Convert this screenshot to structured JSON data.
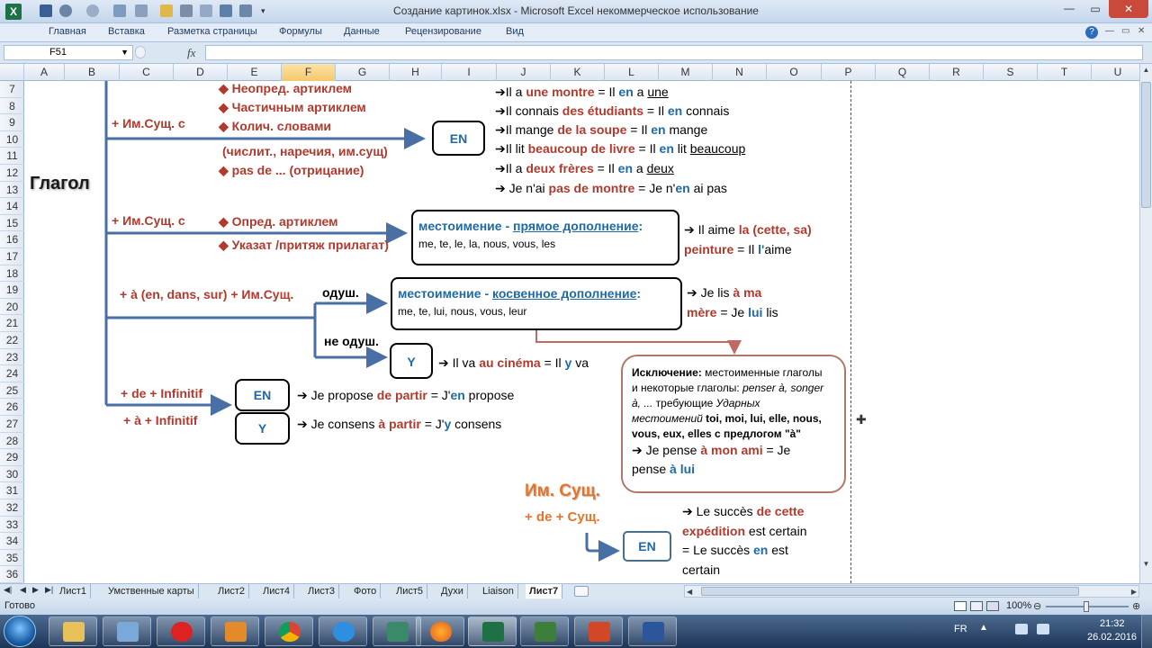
{
  "window": {
    "title": "Создание картинок.xlsx - Microsoft Excel некоммерческое использование"
  },
  "ribbon": {
    "tabs": [
      "Главная",
      "Вставка",
      "Разметка страницы",
      "Формулы",
      "Данные",
      "Рецензирование",
      "Вид"
    ]
  },
  "formula_bar": {
    "name_box": "F51",
    "fx_label": "fx",
    "value": ""
  },
  "columns": [
    "A",
    "B",
    "C",
    "D",
    "E",
    "F",
    "G",
    "H",
    "I",
    "J",
    "K",
    "L",
    "M",
    "N",
    "O",
    "P",
    "Q",
    "R",
    "S",
    "T",
    "U"
  ],
  "rows": [
    "7",
    "8",
    "9",
    "10",
    "11",
    "12",
    "13",
    "14",
    "15",
    "16",
    "17",
    "18",
    "19",
    "20",
    "21",
    "22",
    "23",
    "24",
    "25",
    "26",
    "27",
    "28",
    "29",
    "30",
    "31",
    "32",
    "33",
    "34",
    "35",
    "36"
  ],
  "diagram": {
    "verb": "Глагол",
    "branch1": {
      "label": "+ Им.Сущ.  с",
      "bullets": [
        "Неопред. артиклем",
        "Частичным артиклем",
        "Колич. словами",
        "(числит., наречия, им.сущ)",
        "pas de ... (отрицание)"
      ],
      "box": "EN",
      "examples": [
        {
          "a": "Il a ",
          "b": "une montre",
          "c": " = Il ",
          "d": "en",
          "e": " a ",
          "f": "une"
        },
        {
          "a": "Il connais ",
          "b": "des étudiants",
          "c": " = Il ",
          "d": "en",
          "e": " connais",
          "f": ""
        },
        {
          "a": "Il mange ",
          "b": "de la soupe",
          "c": " = Il ",
          "d": "en",
          "e": " mange",
          "f": ""
        },
        {
          "a": "Il lit ",
          "b": "beaucoup de livre",
          "c": " = Il ",
          "d": "en",
          "e": " lit ",
          "f": "beaucoup"
        },
        {
          "a": "Il a ",
          "b": "deux frères",
          "c": " = Il ",
          "d": "en",
          "e": " a ",
          "f": "deux"
        },
        {
          "a": "Je n'ai ",
          "b": "pas de montre",
          "c": " = Je n'",
          "d": "en",
          "e": " ai pas",
          "f": ""
        }
      ]
    },
    "branch2": {
      "label": "+ Им.Сущ.  с",
      "bullets": [
        "Опред. артиклем",
        "Указат /притяж прилагат)"
      ],
      "box_title_a": "местоимение - ",
      "box_title_b": "прямое дополнение",
      "box_title_c": ":",
      "box_list": "me, te, le, la, nous, vous, les",
      "ex_a": "Il aime ",
      "ex_b": "la (cette, sa)",
      "ex_c": "peinture",
      "ex_d": " = Il ",
      "ex_e": "l'",
      "ex_f": "aime"
    },
    "branch3": {
      "label": "+ à (en, dans, sur) + Им.Сущ.",
      "animate": "одуш.",
      "inanimate": "не одуш.",
      "box_title_a": "местоимение - ",
      "box_title_b": "косвенное дополнение",
      "box_title_c": ":",
      "box_list": "me, te, lui, nous, vous, leur",
      "ex_a": "Je lis ",
      "ex_b": "à ma",
      "ex_c": "mère",
      "ex_d": " = Je ",
      "ex_e": "lui",
      "ex_f": " lis",
      "y_box": "Y",
      "y_ex_a": "Il va ",
      "y_ex_b": "au cinéma",
      "y_ex_c": " = Il ",
      "y_ex_d": "y",
      "y_ex_e": " va"
    },
    "exception": {
      "l1a": "Исключение:",
      "l1b": " местоименные глаголы",
      "l2a": "и некоторые глаголы: ",
      "l2b": "penser à, songer",
      "l3a": "à, ...",
      "l3b": " требующие ",
      "l3c": "Ударных",
      "l4a": "местоимений",
      "l4b": "  toi, moi, lui, elle, nous,",
      "l5": "vous, eux, elles с предлогом \"à\"",
      "l6a": "Je pense ",
      "l6b": "à mon ami",
      "l6c": " = Je",
      "l7a": "pense ",
      "l7b": "à lui"
    },
    "branch4": {
      "label_de": "+ de + Infinitif",
      "label_a": "+ à + Infinitif",
      "box_en": "EN",
      "box_y": "Y",
      "ex1_a": "Je propose ",
      "ex1_b": "de partir",
      "ex1_c": " = J'",
      "ex1_d": "en",
      "ex1_e": " propose",
      "ex2_a": "Je consens ",
      "ex2_b": "à partir",
      "ex2_c": " = J'",
      "ex2_d": "y",
      "ex2_e": " consens"
    },
    "noun": {
      "title": "Им. Сущ.",
      "sub": "+ de + Сущ.",
      "box": "EN",
      "ex1a": "Le succès ",
      "ex1b": "de cette",
      "ex2a": "expédition",
      "ex2b": " est certain",
      "ex3a": "= Le succès ",
      "ex3b": "en",
      "ex3c": " est",
      "ex4": "certain"
    }
  },
  "sheet_tabs": [
    "Лист1",
    "Умственные карты",
    "Лист2",
    "Лист4",
    "Лист3",
    "Фото",
    "Лист5",
    "Духи",
    "Liaison",
    "Лист7"
  ],
  "active_sheet": "Лист7",
  "status": {
    "ready": "Готово",
    "zoom": "100%"
  },
  "tray": {
    "lang": "FR",
    "time": "21:32",
    "date": "26.02.2016"
  },
  "colors": {
    "red": "#b03a2e",
    "blue": "#1f6aa5",
    "orange": "#e8742a",
    "arrow": "#4a6fa5",
    "exception_border": "#b0786a"
  }
}
